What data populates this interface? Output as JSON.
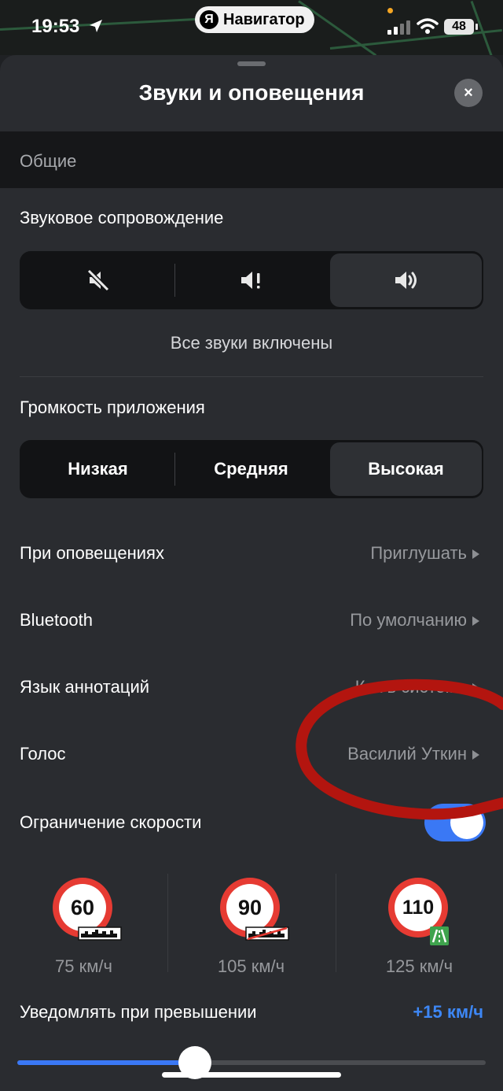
{
  "status_bar": {
    "time": "19:53",
    "app_name": "Навигатор",
    "app_logo_letter": "Я",
    "battery": "48",
    "icons": [
      "location-arrow-icon",
      "signal-icon",
      "wifi-icon",
      "battery-icon"
    ]
  },
  "sheet": {
    "title": "Звуки и оповещения",
    "close_icon": "×"
  },
  "general": {
    "section_title": "Общие",
    "sound_guidance": {
      "label": "Звуковое сопровождение",
      "options": [
        "mute-icon",
        "alerts-only-icon",
        "all-sounds-icon"
      ],
      "selected_index": 2,
      "caption": "Все звуки включены"
    },
    "volume": {
      "label": "Громкость приложения",
      "options": [
        "Низкая",
        "Средняя",
        "Высокая"
      ],
      "selected_index": 2
    },
    "settings_rows": [
      {
        "label": "При оповещениях",
        "value": "Приглушать"
      },
      {
        "label": "Bluetooth",
        "value": "По умолчанию"
      },
      {
        "label": "Язык аннотаций",
        "value": "Как в системе"
      },
      {
        "label": "Голос",
        "value": "Василий Уткин"
      }
    ],
    "speed_limit": {
      "label": "Ограничение скорости",
      "enabled": true,
      "signs": [
        {
          "limit": "60",
          "road_type": "city",
          "alert_at": "75 км/ч"
        },
        {
          "limit": "90",
          "road_type": "outside-city",
          "alert_at": "105 км/ч"
        },
        {
          "limit": "110",
          "road_type": "highway",
          "alert_at": "125 км/ч"
        }
      ]
    },
    "exceed": {
      "label": "Уведомлять при превышении",
      "value": "+15 км/ч",
      "slider_fraction": 0.38
    }
  },
  "colors": {
    "accent": "#3a78f5",
    "sign_red": "#e63b33",
    "annotation": "#b3150f",
    "background": "#2a2c30"
  }
}
